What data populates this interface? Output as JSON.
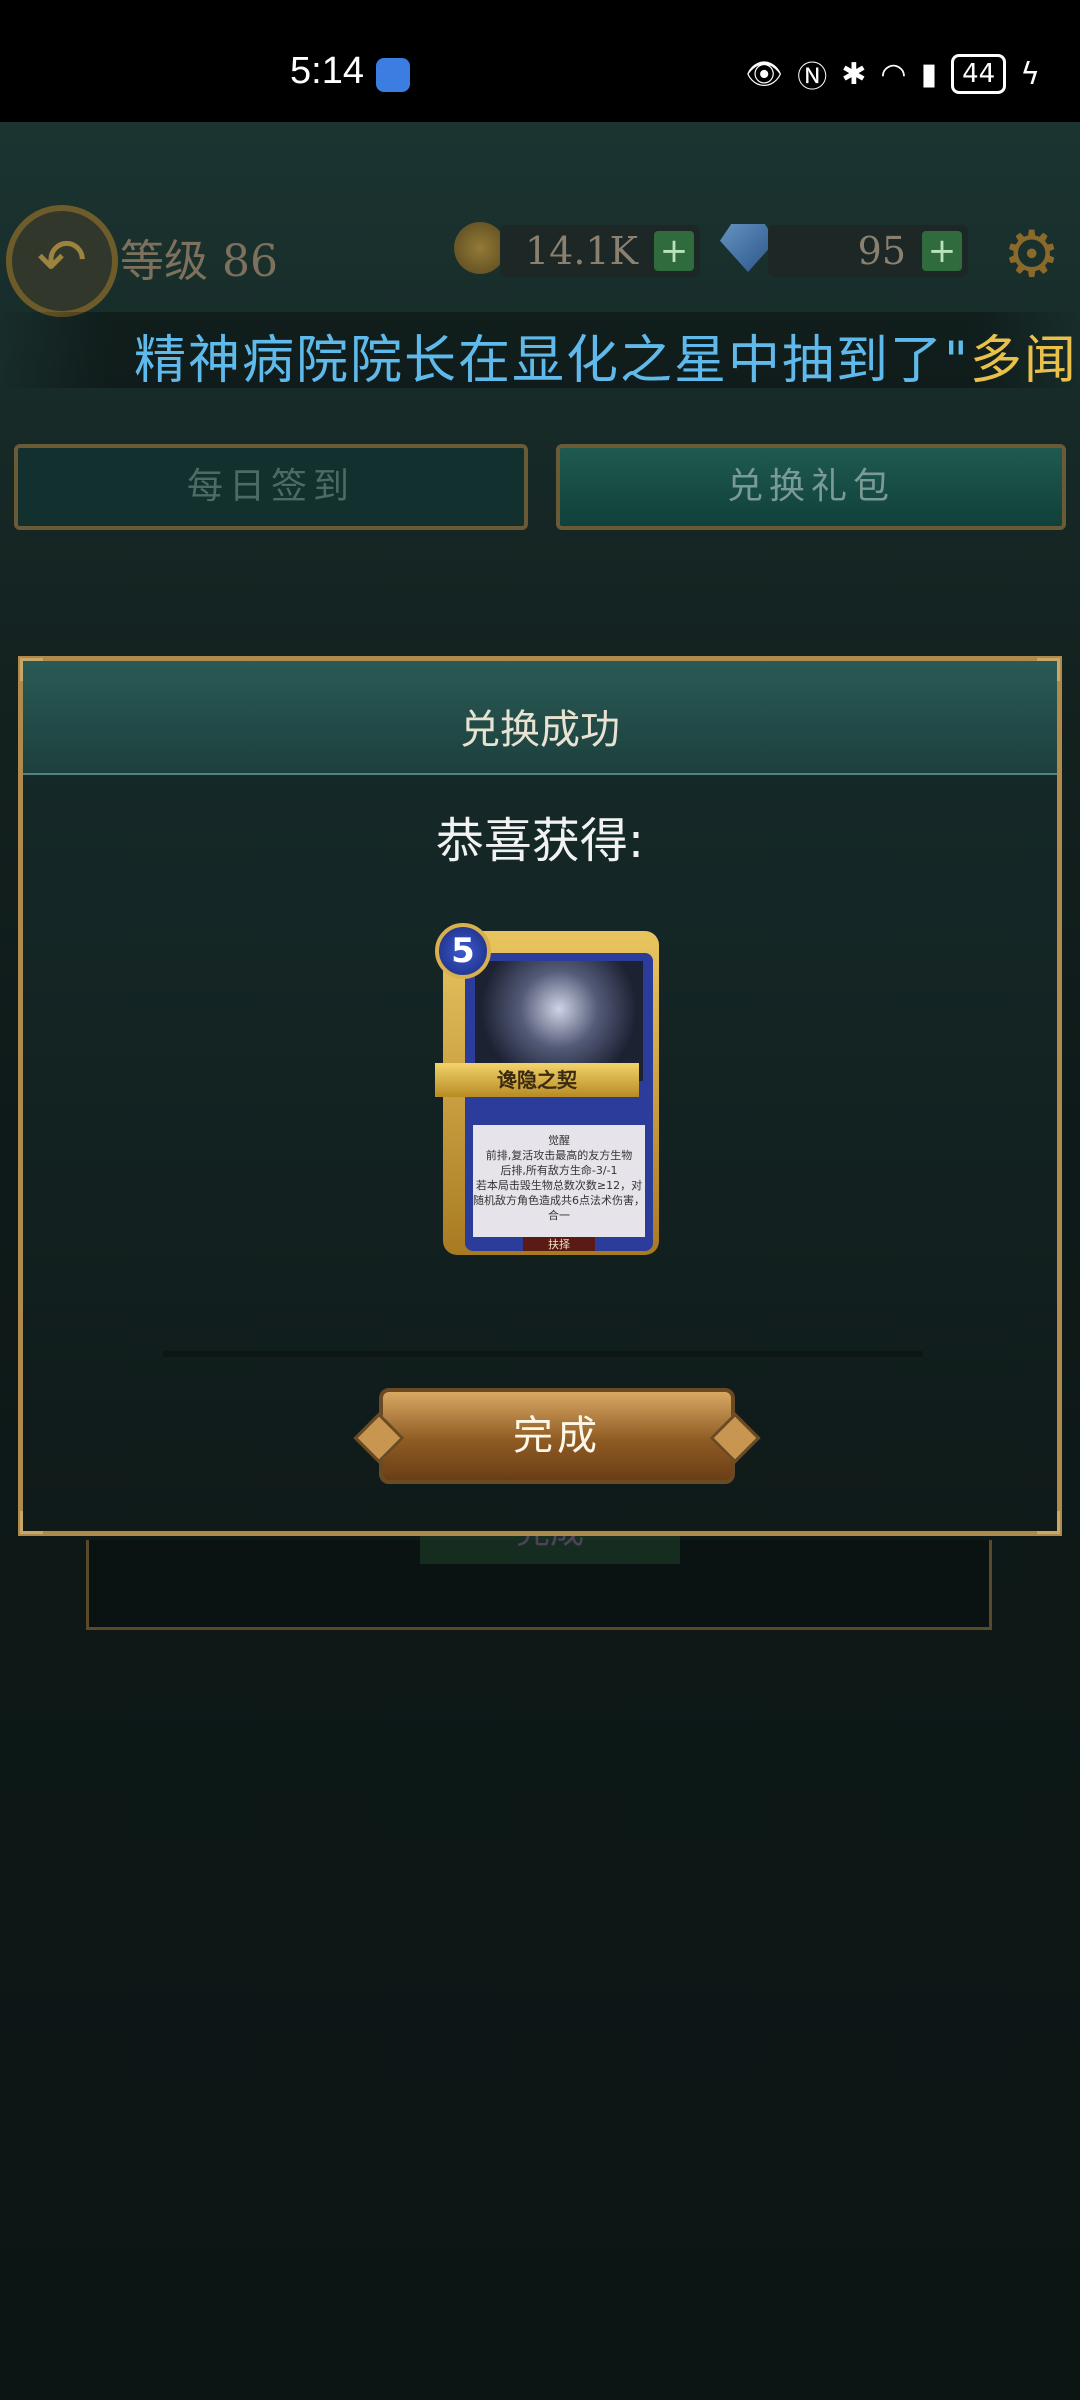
{
  "status_bar": {
    "time": "5:14",
    "battery": "44"
  },
  "header": {
    "level_label": "等级 86",
    "coins": "14.1K",
    "gems": "95",
    "plus": "+"
  },
  "marquee": {
    "text": "精神病院院长在显化之星中抽到了\"",
    "highlight": "多闻"
  },
  "tabs": [
    {
      "label": "每日签到"
    },
    {
      "label": "兑换礼包"
    }
  ],
  "modal": {
    "title": "兑换成功",
    "congrats": "恭喜获得:",
    "done_label": "完成",
    "card": {
      "cost": "5",
      "name": "谗隐之契",
      "description": "觉醒\n前排,复活攻击最高的友方生物\n后排,所有敌方生命-3/-1\n若本局击毁生物总数次数≥12，对随机敌方角色造成共6点法术伤害，合一",
      "footer": "扶择"
    }
  },
  "background_ghost": {
    "done_label": "完成"
  }
}
